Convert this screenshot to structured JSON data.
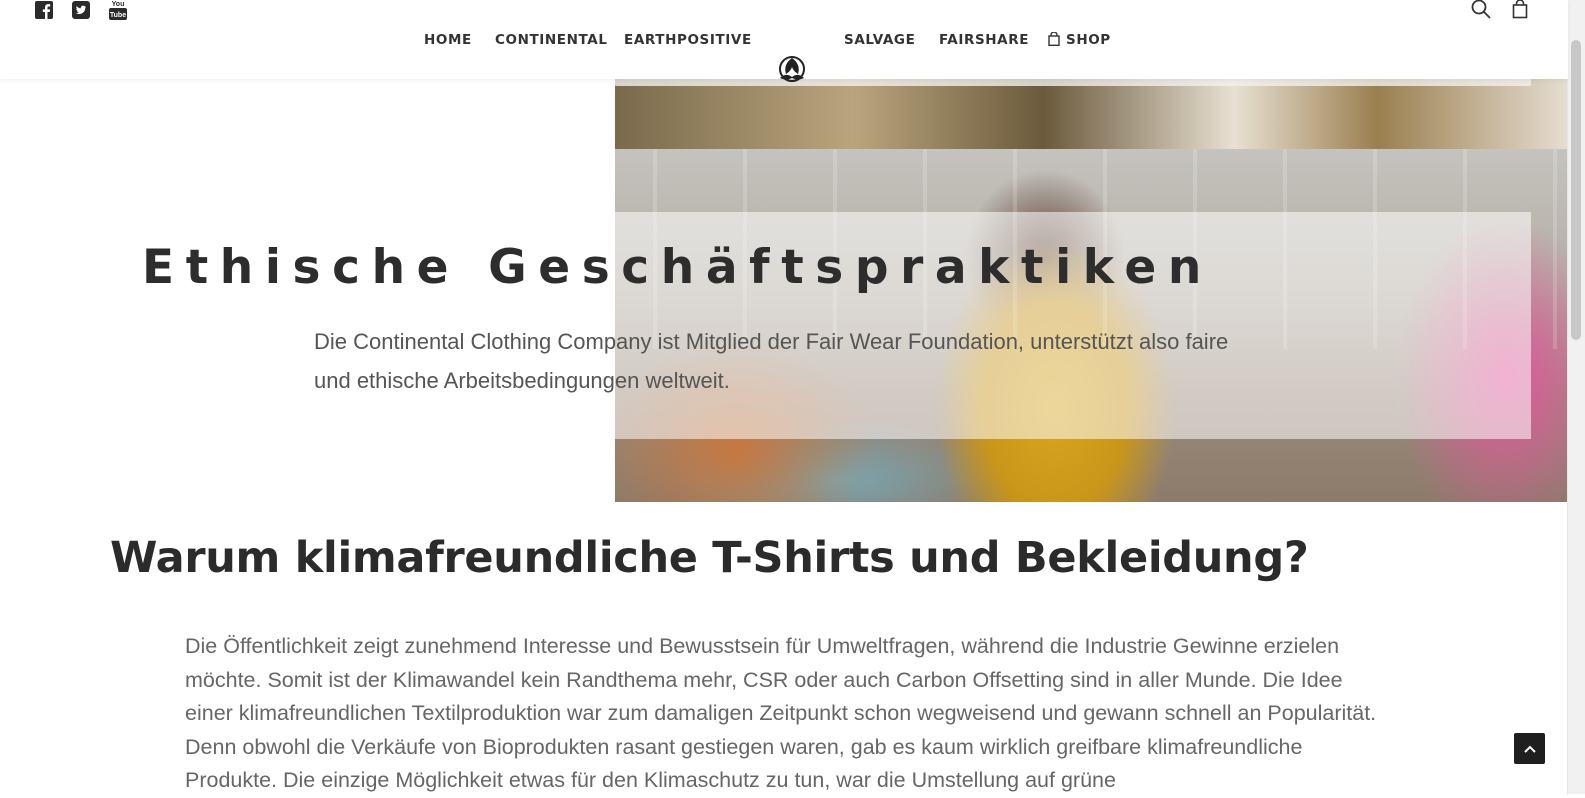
{
  "social": {
    "icons": [
      "facebook-icon",
      "twitter-icon",
      "youtube-icon"
    ]
  },
  "nav": {
    "home": "HOME",
    "continental": "CONTINENTAL",
    "earthpositive": "EARTHPOSITIVE",
    "salvage": "SALVAGE",
    "fairshare": "FAIRSHARE",
    "shop": "SHOP",
    "logo_icon": "brand-logo-icon"
  },
  "tools": {
    "search_icon": "search-icon",
    "cart_icon": "shopping-bag-icon"
  },
  "hero": {
    "title": "Ethische Geschäftspraktiken",
    "text": "Die Continental Clothing Company ist Mitglied der Fair Wear Foundation, unterstützt also faire und ethische Arbeitsbedingungen weltweit."
  },
  "content": {
    "title": "Warum klimafreundliche T-Shirts und Bekleidung?",
    "body": "Die Öffentlichkeit zeigt zunehmend Interesse und Bewusstsein für Umweltfragen, während die Industrie Gewinne erzielen möchte. Somit ist der Klimawandel kein Randthema mehr, CSR oder auch Carbon Offsetting sind in aller Munde. Die Idee einer klimafreundlichen Textilproduktion war zum damaligen Zeitpunkt schon wegweisend und gewann schnell an Popularität. Denn obwohl die Verkäufe von Bioprodukten rasant gestiegen waren, gab es kaum wirklich greifbare klimafreundliche Produkte. Die einzige Möglichkeit etwas für den Klimaschutz zu tun, war die Umstellung auf grüne"
  },
  "colors": {
    "text_dark": "#2b2b2b",
    "text_muted": "#666666",
    "button_dark": "#1f1f1f"
  }
}
